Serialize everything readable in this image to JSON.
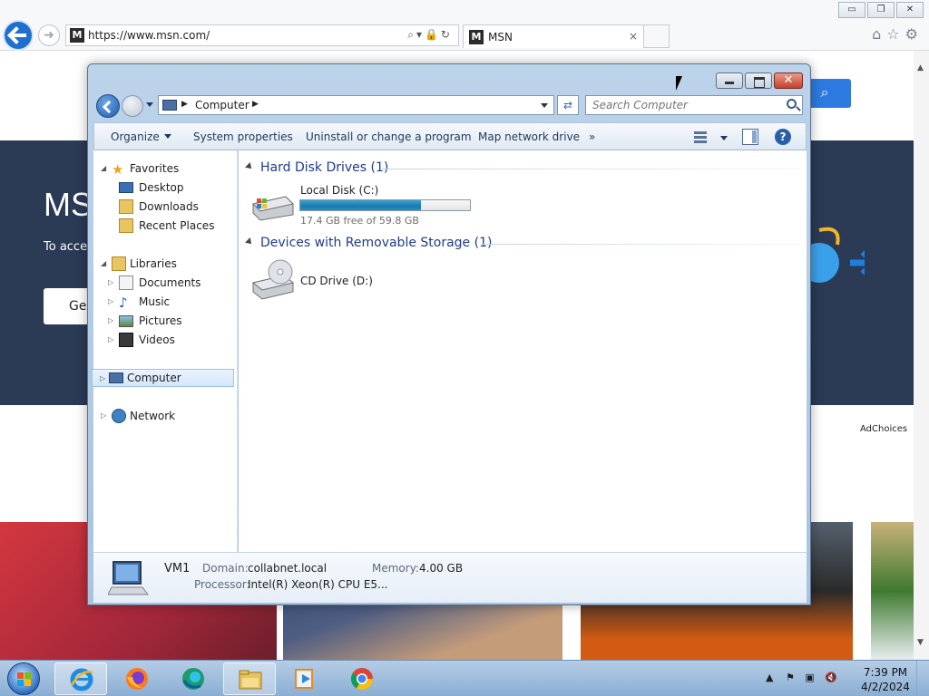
{
  "browser": {
    "url": "https://www.msn.com/",
    "tab_title": "MSN",
    "tab_close": "×",
    "favicon": "M",
    "window_controls": {
      "minimize": "▭",
      "restore": "❐",
      "close": "✕"
    }
  },
  "msn_page": {
    "headline": "MS",
    "subtext": "To acces",
    "button_label": "Ge",
    "ad_choices": "AdChoices"
  },
  "explorer": {
    "breadcrumb": "Computer",
    "search_placeholder": "Search Computer",
    "toolbar": {
      "organize": "Organize",
      "system_properties": "System properties",
      "uninstall": "Uninstall or change a program",
      "map_drive": "Map network drive",
      "more": "»"
    },
    "nav": {
      "favorites": "Favorites",
      "desktop": "Desktop",
      "downloads": "Downloads",
      "recent_places": "Recent Places",
      "libraries": "Libraries",
      "documents": "Documents",
      "music": "Music",
      "pictures": "Pictures",
      "videos": "Videos",
      "computer": "Computer",
      "network": "Network"
    },
    "groups": {
      "hard_disk": "Hard Disk Drives (1)",
      "removable": "Devices with Removable Storage (1)"
    },
    "drives": {
      "local_disk_name": "Local Disk (C:)",
      "local_disk_free": "17.4 GB free of 59.8 GB",
      "local_disk_used_fraction": 0.709,
      "cd_drive_name": "CD Drive (D:)"
    },
    "details": {
      "computer_name": "VM1",
      "domain_label": "Domain:",
      "domain_value": "collabnet.local",
      "memory_label": "Memory:",
      "memory_value": "4.00 GB",
      "processor_label": "Processor:",
      "processor_value": "Intel(R) Xeon(R) CPU E5..."
    }
  },
  "taskbar": {
    "time": "7:39 PM",
    "date": "4/2/2024"
  },
  "colors": {
    "ie_blue": "#1f6fd0",
    "msn_band": "#2b3a55",
    "group_heading": "#1e3b8a",
    "disk_fill": "#1a79ab"
  }
}
